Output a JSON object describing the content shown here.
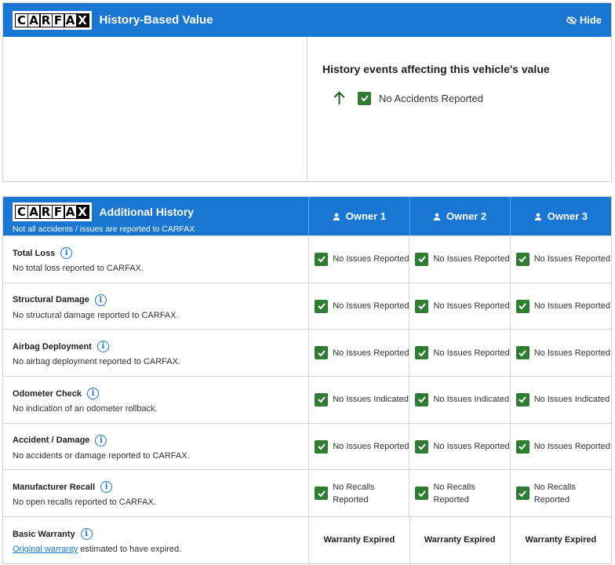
{
  "brand": {
    "logo_letters": [
      "C",
      "A",
      "R",
      "F",
      "A",
      "X"
    ]
  },
  "top_card": {
    "title": "History-Based Value",
    "hide_label": "Hide",
    "events_heading": "History events affecting this vehicle's value",
    "event": "No Accidents Reported"
  },
  "history_card": {
    "title": "Additional History",
    "subtitle": "Not all accidents / issues are reported to CARFAX",
    "owners": [
      "Owner 1",
      "Owner 2",
      "Owner 3"
    ],
    "rows": [
      {
        "title": "Total Loss",
        "desc": "No total loss reported to CARFAX.",
        "values": [
          "No Issues Reported",
          "No Issues Reported",
          "No Issues Reported"
        ]
      },
      {
        "title": "Structural Damage",
        "desc": "No structural damage reported to CARFAX.",
        "values": [
          "No Issues Reported",
          "No Issues Reported",
          "No Issues Reported"
        ]
      },
      {
        "title": "Airbag Deployment",
        "desc": "No airbag deployment reported to CARFAX.",
        "values": [
          "No Issues Reported",
          "No Issues Reported",
          "No Issues Reported"
        ]
      },
      {
        "title": "Odometer Check",
        "desc": "No indication of an odometer rollback.",
        "values": [
          "No Issues Indicated",
          "No Issues Indicated",
          "No Issues Indicated"
        ]
      },
      {
        "title": "Accident / Damage",
        "desc": "No accidents or damage reported to CARFAX.",
        "values": [
          "No Issues Reported",
          "No Issues Reported",
          "No Issues Reported"
        ]
      },
      {
        "title": "Manufacturer Recall",
        "desc": "No open recalls reported to CARFAX.",
        "values": [
          "No Recalls Reported",
          "No Recalls Reported",
          "No Recalls Reported"
        ]
      }
    ],
    "warranty": {
      "title": "Basic Warranty",
      "link_text": "Original warranty",
      "desc_rest": " estimated to have expired.",
      "values": [
        "Warranty Expired",
        "Warranty Expired",
        "Warranty Expired"
      ]
    }
  },
  "colors": {
    "header_blue": "#1976d2",
    "check_green": "#2e7d32"
  },
  "icons": {
    "hide": "eye-off-icon",
    "arrow": "arrow-up-icon",
    "check": "checkbox-checked-icon",
    "info": "info-icon",
    "owner": "person-icon"
  }
}
